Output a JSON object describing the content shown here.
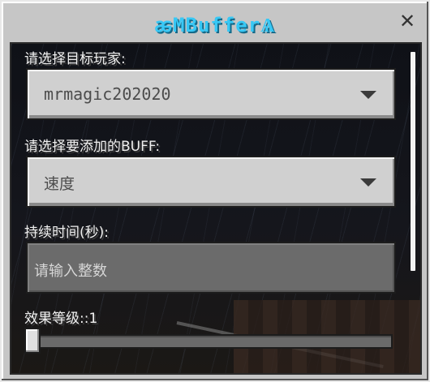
{
  "dialog": {
    "title": "MBuffer",
    "close_glyph": "✕"
  },
  "form": {
    "player_label": "请选择目标玩家:",
    "player_value": "mrmagic202020",
    "buff_label": "请选择要添加的BUFF:",
    "buff_value": "速度",
    "duration_label": "持续时间(秒):",
    "duration_placeholder": "请输入整数",
    "level_label": "效果等级::1",
    "level_value": 1
  },
  "colors": {
    "title": "#38c8f5",
    "panel": "#c6c6c6"
  },
  "icons": {
    "title_left": "bee-icon",
    "title_right": "bee-icon",
    "close": "close-icon",
    "dropdown": "caret-down-icon"
  }
}
